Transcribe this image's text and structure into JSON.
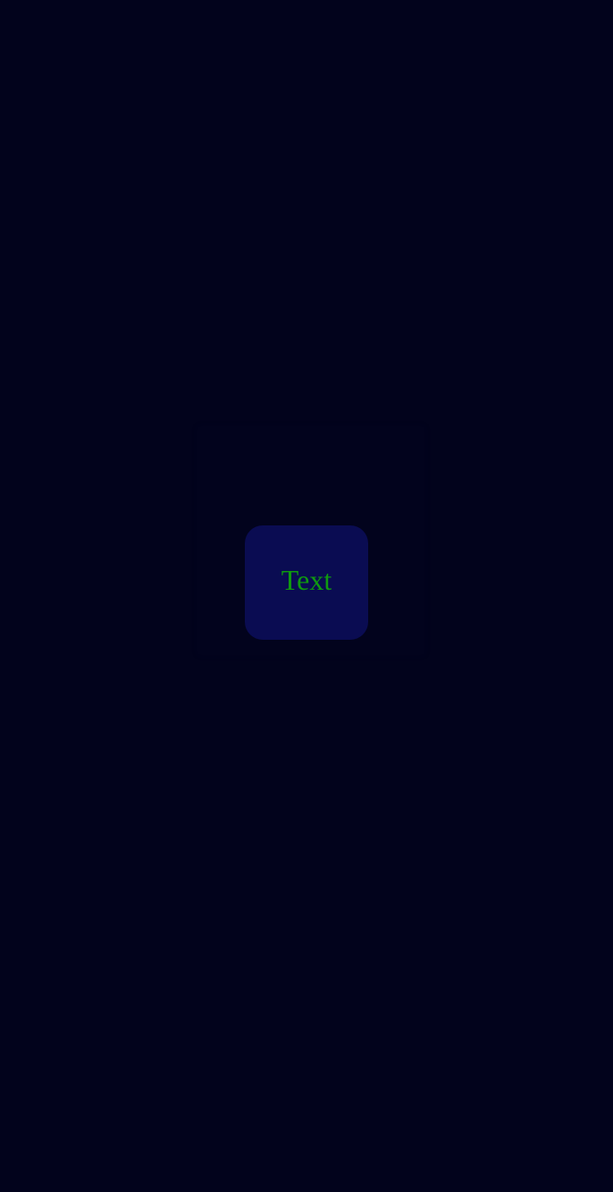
{
  "screen": {
    "background_color": "#02031c"
  },
  "panel": {
    "background_color": "#02031d"
  },
  "text_button": {
    "label": "Text",
    "background_color": "#0a0c52",
    "text_color": "#0f9a0f"
  }
}
